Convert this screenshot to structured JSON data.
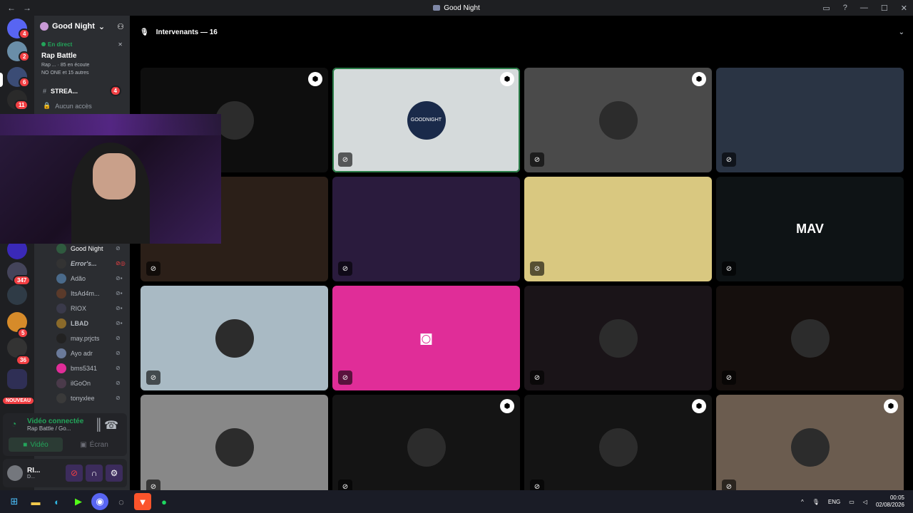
{
  "window": {
    "title": "Good Night"
  },
  "guild_badges": [
    "4",
    "2",
    "6",
    "11",
    "347",
    "5",
    "36",
    "NOUVEAU"
  ],
  "server": {
    "name": "Good Night"
  },
  "live": {
    "label": "En direct",
    "title": "Rap Battle",
    "line1a": "Rap ...",
    "line1b": "85 en écoute",
    "line2": "NO ONE et 15 autres"
  },
  "channels": [
    {
      "name": "STREA...",
      "badge": "4"
    },
    {
      "name": "Aucun accès"
    }
  ],
  "members": [
    "Good Night",
    "Error's...",
    "Adão",
    "ItsAd4m...",
    "RIOX",
    "LBAD",
    "may.prjcts",
    "Ayo adr",
    "bms5341",
    "ilGoOn",
    "tonyxlee"
  ],
  "voice": {
    "connected": "Vidéo connectée",
    "channel": "Rap Battle / Go...",
    "video_btn": "Vidéo",
    "screen_btn": "Écran"
  },
  "user": {
    "name": "RI...",
    "status": "D..."
  },
  "main": {
    "header": "Intervenants — 16"
  },
  "tiles": [
    {
      "bg": "#0e0e0e",
      "shield": true,
      "mute": false
    },
    {
      "bg": "#d5dadb",
      "shield": true,
      "mute": true,
      "speaking": true
    },
    {
      "bg": "#4a4a4a",
      "shield": true,
      "mute": true
    },
    {
      "bg": "#2a3444",
      "shield": false,
      "mute": true
    },
    {
      "bg": "#2b1f18",
      "shield": false,
      "mute": true
    },
    {
      "bg": "#2a1b3d",
      "shield": false,
      "mute": true
    },
    {
      "bg": "#d9c880",
      "shield": false,
      "mute": true
    },
    {
      "bg": "#0e1315",
      "shield": false,
      "mute": true
    },
    {
      "bg": "#a9bac4",
      "shield": false,
      "mute": true
    },
    {
      "bg": "#e02d98",
      "shield": false,
      "mute": true
    },
    {
      "bg": "#1a1418",
      "shield": false,
      "mute": true
    },
    {
      "bg": "#150f0d",
      "shield": false,
      "mute": true
    },
    {
      "bg": "#888888",
      "shield": false,
      "mute": true
    },
    {
      "bg": "#141414",
      "shield": true,
      "mute": true
    },
    {
      "bg": "#141414",
      "shield": true,
      "mute": true
    },
    {
      "bg": "#6b5c4f",
      "shield": true,
      "mute": true
    }
  ],
  "tile_labels": {
    "mav": "MAV",
    "gn": "GOODNIGHT"
  },
  "taskbar": {
    "lang": "ENG",
    "time": "00:05",
    "date": "02/08/2026"
  }
}
